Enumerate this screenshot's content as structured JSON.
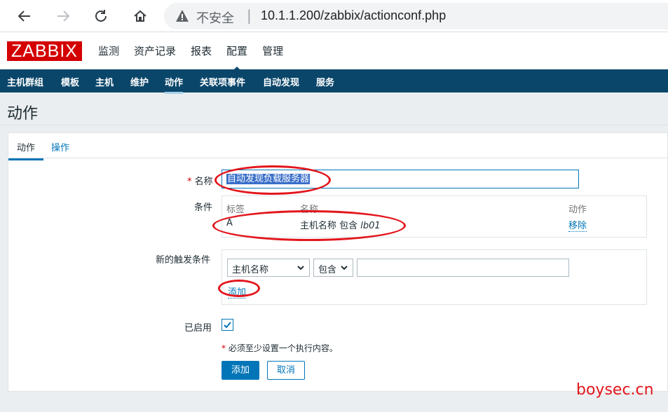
{
  "browser": {
    "insecure_label": "不安全",
    "url": "10.1.1.200/zabbix/actionconf.php"
  },
  "header": {
    "logo": "ZABBIX",
    "menu": [
      {
        "label": "监测"
      },
      {
        "label": "资产记录"
      },
      {
        "label": "报表"
      },
      {
        "label": "配置"
      },
      {
        "label": "管理"
      }
    ]
  },
  "subnav": {
    "items": [
      {
        "label": "主机群组"
      },
      {
        "label": "模板"
      },
      {
        "label": "主机"
      },
      {
        "label": "维护"
      },
      {
        "label": "动作"
      },
      {
        "label": "关联项事件"
      },
      {
        "label": "自动发现"
      },
      {
        "label": "服务"
      }
    ]
  },
  "page": {
    "title": "动作"
  },
  "tabs": [
    {
      "label": "动作"
    },
    {
      "label": "操作"
    }
  ],
  "form": {
    "required_mark": "*",
    "name_label": "名称",
    "name_value": "自动发现负载服务器",
    "conditions_label": "条件",
    "conditions_headers": {
      "label": "标签",
      "name": "名称",
      "action": "动作"
    },
    "conditions_row": {
      "label": "A",
      "name_prefix": "主机名称 包含 ",
      "name_value": "lb01",
      "action": "移除"
    },
    "new_condition_label": "新的触发条件",
    "condition_type": "主机名称",
    "operator": "包含",
    "condition_value": "",
    "add_link": "添加",
    "enabled_label": "已启用",
    "enabled": true,
    "note_mark": "*",
    "note": "必须至少设置一个执行内容。",
    "submit": "添加",
    "cancel": "取消"
  },
  "watermark": "boysec.cn",
  "colors": {
    "zabbix_red": "#d40000",
    "nav_blue": "#0a466a",
    "link_blue": "#0275b8",
    "annotation_red": "#e3161c"
  }
}
